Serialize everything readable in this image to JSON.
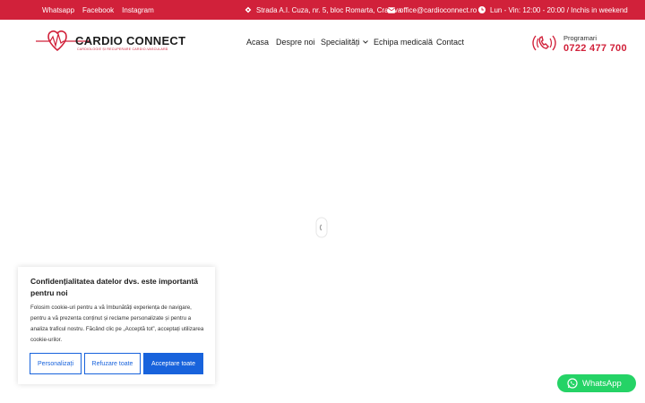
{
  "topbar": {
    "social": [
      "Whatsapp",
      "Facebook",
      "Instagram"
    ],
    "address": "Strada A.I. Cuza, nr. 5, bloc Romarta, Craiova",
    "email": "office@cardioconnect.ro",
    "hours": "Lun - Vin: 12:00 - 20:00 / Inchis in weekend"
  },
  "logo": {
    "title": "CARDIO CONNECT",
    "subtitle": "CARDIOLOGIE ȘI RECUPERARE CARDIO-VASCULARĂ"
  },
  "nav": {
    "items": [
      "Acasa",
      "Despre noi",
      "Specialități",
      "Echipa medicală",
      "Contact"
    ]
  },
  "contact": {
    "label": "Programari",
    "phone": "0722 477 700"
  },
  "cookie": {
    "title": "Confidențialitatea datelor dvs. este importantă pentru noi",
    "text": "Folosim cookie-uri pentru a vă îmbunătăți experiența de navigare, pentru a vă prezenta conținut și reclame personalizate și pentru a analiza traficul nostru. Făcând clic pe „Acceptă tot”, acceptați utilizarea cookie-urilor.",
    "buttons": [
      "Personalizați",
      "Refuzare toate",
      "Acceptare toate"
    ]
  },
  "whatsapp_label": "WhatsApp",
  "colors": {
    "brand_red": "#d1213a",
    "button_blue": "#1863dc",
    "whatsapp_green": "#25d366"
  }
}
